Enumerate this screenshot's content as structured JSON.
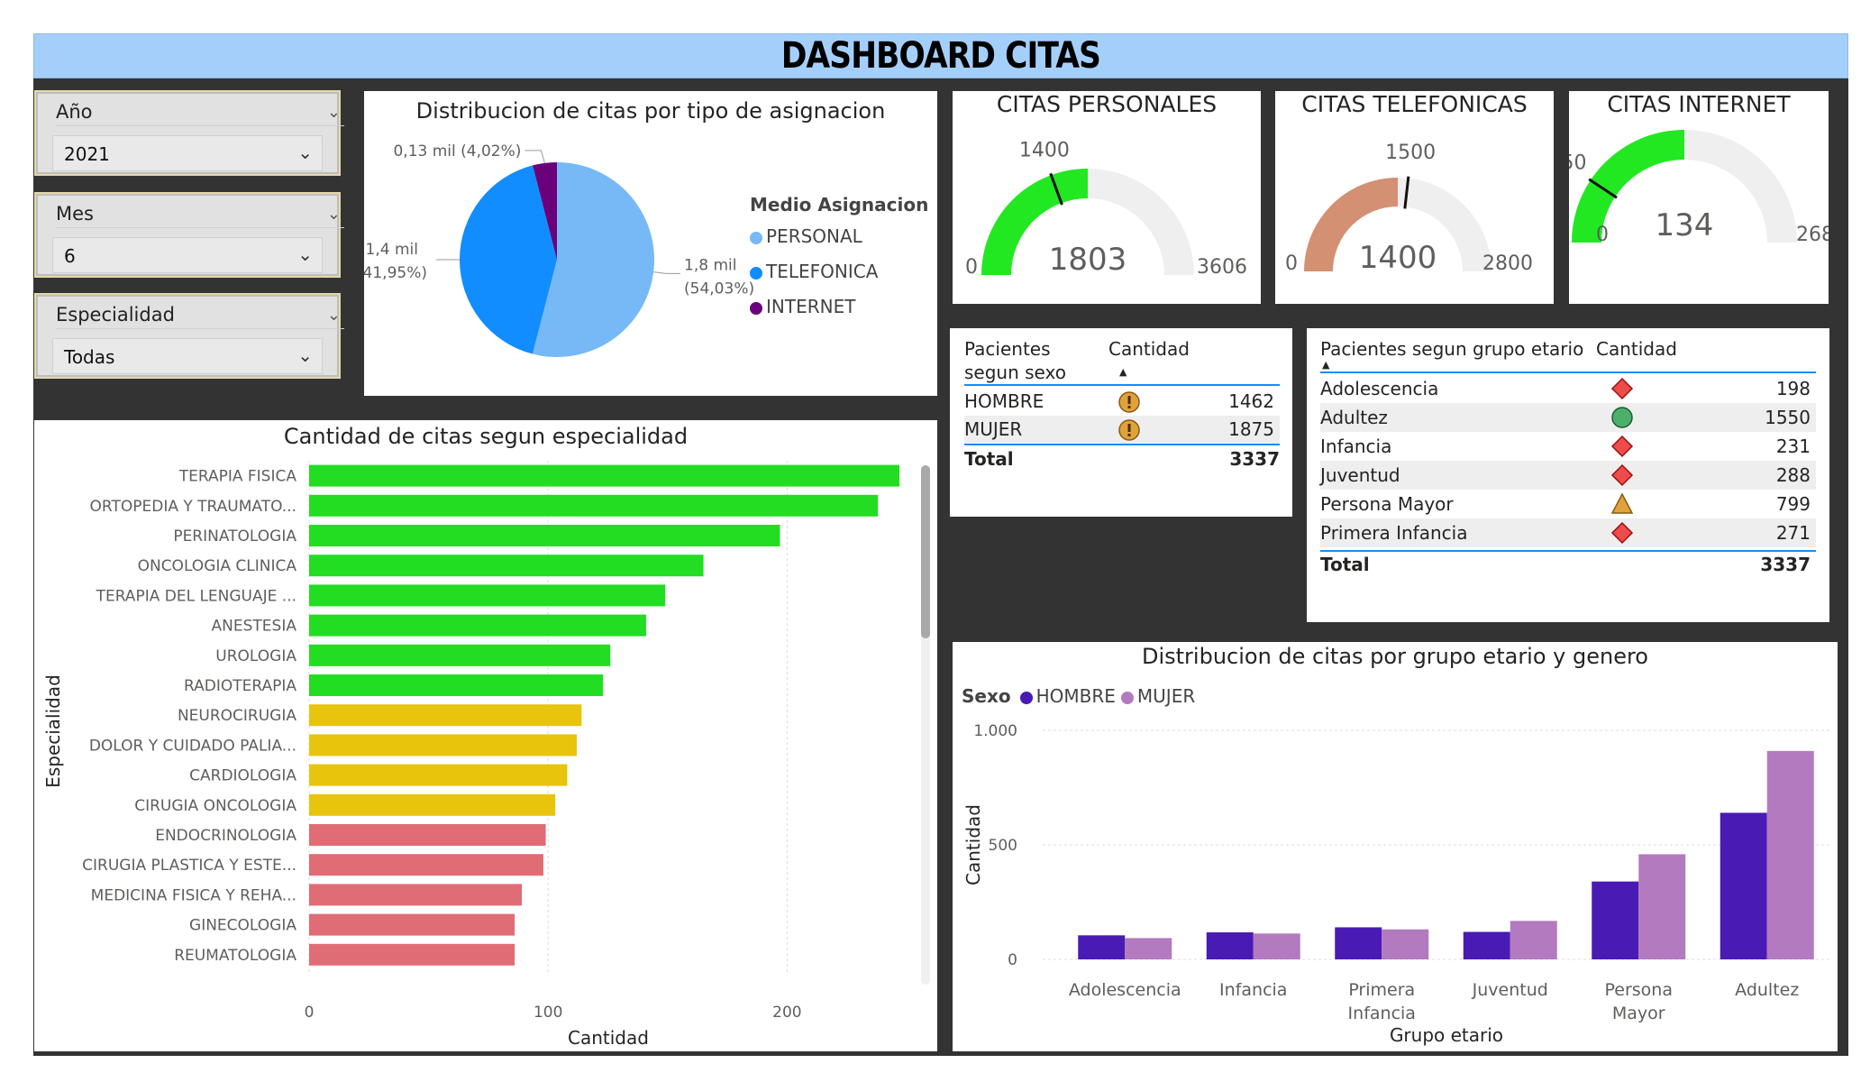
{
  "title": "DASHBOARD CITAS",
  "filters": [
    {
      "label": "Año",
      "value": "2021"
    },
    {
      "label": "Mes",
      "value": "6"
    },
    {
      "label": "Especialidad",
      "value": "Todas"
    }
  ],
  "pie": {
    "title": "Distribucion de citas por tipo de asignacion",
    "legend_title": "Medio Asignacion",
    "slices": [
      {
        "name": "PERSONAL",
        "value": 1803,
        "percent": 54.03,
        "label": "1,8 mil",
        "pct_label": "(54,03%)",
        "color": "#76b9f6"
      },
      {
        "name": "TELEFONICA",
        "value": 1400,
        "percent": 41.95,
        "label": "1,4 mil",
        "pct_label": "(41,95%)",
        "color": "#118dff"
      },
      {
        "name": "INTERNET",
        "value": 134,
        "percent": 4.02,
        "label": "0,13 mil (4,02%)",
        "pct_label": "",
        "color": "#6b007b"
      }
    ]
  },
  "gauges": [
    {
      "title": "CITAS PERSONALES",
      "value": 1803,
      "value_label": "1803",
      "min": 0,
      "min_label": "0",
      "max": 3606,
      "max_label": "3606",
      "target": 1400,
      "target_label": "1400",
      "color": "#22e822"
    },
    {
      "title": "CITAS TELEFONICAS",
      "value": 1400,
      "value_label": "1400",
      "min": 0,
      "min_label": "0",
      "max": 2800,
      "max_label": "2800",
      "target": 1500,
      "target_label": "1500",
      "color": "#d39072"
    },
    {
      "title": "CITAS INTERNET",
      "value": 134,
      "value_label": "134",
      "min": 0,
      "min_label": "0",
      "max": 268,
      "max_label": "268",
      "target": 50,
      "target_label": "50",
      "color": "#22e822"
    }
  ],
  "sex_table": {
    "header1_line1": "Pacientes",
    "header1_line2": "segun sexo",
    "header2": "Cantidad",
    "rows": [
      {
        "label": "HOMBRE",
        "value": "1462",
        "icon": "warning-icon"
      },
      {
        "label": "MUJER",
        "value": "1875",
        "icon": "warning-icon"
      }
    ],
    "total_label": "Total",
    "total_value": "3337"
  },
  "age_table": {
    "header1": "Pacientes segun grupo etario",
    "header2": "Cantidad",
    "rows": [
      {
        "label": "Adolescencia",
        "value": "198",
        "icon": "red-diamond-icon"
      },
      {
        "label": "Adultez",
        "value": "1550",
        "icon": "green-circle-icon"
      },
      {
        "label": "Infancia",
        "value": "231",
        "icon": "red-diamond-icon"
      },
      {
        "label": "Juventud",
        "value": "288",
        "icon": "red-diamond-icon"
      },
      {
        "label": "Persona Mayor",
        "value": "799",
        "icon": "yellow-triangle-icon"
      },
      {
        "label": "Primera Infancia",
        "value": "271",
        "icon": "red-diamond-icon"
      }
    ],
    "total_label": "Total",
    "total_value": "3337"
  },
  "chart_data": [
    {
      "type": "bar",
      "orientation": "horizontal",
      "title": "Cantidad de citas segun especialidad",
      "xlabel": "Cantidad",
      "ylabel": "Especialidad",
      "xlim": [
        0,
        250
      ],
      "xticks": [
        0,
        100,
        200
      ],
      "grid": true,
      "categories": [
        "TERAPIA FISICA",
        "ORTOPEDIA Y TRAUMATO...",
        "PERINATOLOGIA",
        "ONCOLOGIA CLINICA",
        "TERAPIA DEL LENGUAJE ...",
        "ANESTESIA",
        "UROLOGIA",
        "RADIOTERAPIA",
        "NEUROCIRUGIA",
        "DOLOR Y CUIDADO PALIA...",
        "CARDIOLOGIA",
        "CIRUGIA ONCOLOGIA",
        "ENDOCRINOLOGIA",
        "CIRUGIA PLASTICA Y ESTE...",
        "MEDICINA FISICA Y REHA...",
        "GINECOLOGIA",
        "REUMATOLOGIA"
      ],
      "values": [
        247,
        238,
        197,
        165,
        149,
        141,
        126,
        123,
        114,
        112,
        108,
        103,
        99,
        98,
        89,
        86,
        86
      ],
      "colors": [
        "#22dd22",
        "#22dd22",
        "#22dd22",
        "#22dd22",
        "#22dd22",
        "#22dd22",
        "#22dd22",
        "#22dd22",
        "#e8c40c",
        "#e8c40c",
        "#e8c40c",
        "#e8c40c",
        "#e06c75",
        "#e06c75",
        "#e06c75",
        "#e06c75",
        "#e06c75"
      ]
    },
    {
      "type": "bar",
      "title": "Distribucion de citas por grupo etario y genero",
      "xlabel": "Grupo etario",
      "ylabel": "Cantidad",
      "legend_title": "Sexo",
      "legend_position": "top-left",
      "ylim": [
        0,
        1000
      ],
      "yticks": [
        0,
        500,
        1000
      ],
      "ytick_labels": [
        "0",
        "500",
        "1.000"
      ],
      "grid": true,
      "categories": [
        "Adolescencia",
        "Infancia",
        "Primera Infancia",
        "Juventud",
        "Persona Mayor",
        "Adultez"
      ],
      "series": [
        {
          "name": "HOMBRE",
          "color": "#4a1ab5",
          "values": [
            105,
            118,
            140,
            120,
            340,
            640
          ]
        },
        {
          "name": "MUJER",
          "color": "#b37ac0",
          "values": [
            93,
            113,
            131,
            168,
            459,
            910
          ]
        }
      ]
    }
  ]
}
